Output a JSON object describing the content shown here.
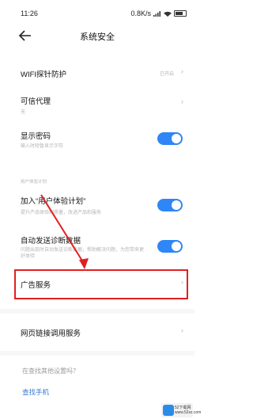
{
  "status_bar": {
    "time": "11:26",
    "net_speed": "0.8K/s"
  },
  "header": {
    "title": "系统安全"
  },
  "items": {
    "wifi": {
      "title": "WIFI探针防护",
      "value": "已开启"
    },
    "trusted_agent": {
      "title": "可信代理",
      "subtitle": "无"
    },
    "show_password": {
      "title": "显示密码",
      "subtitle": "输入时短暂显示字符",
      "enabled": true
    },
    "section_label": "用户体验计划",
    "ux_plan": {
      "title": "加入“用户体验计划”",
      "subtitle": "提升产品体验和质量，改进产品和服务",
      "enabled": true
    },
    "auto_diag": {
      "title": "自动发送诊断数据",
      "subtitle": "问题出现时自动发送诊断数据，帮助解决问题，为您带来更好体验",
      "enabled": true
    },
    "ad_service": {
      "title": "广告服务"
    },
    "web_link": {
      "title": "网页链接调用服务"
    }
  },
  "footer": {
    "question": "在查找其他设置吗？",
    "link": "查找手机"
  },
  "watermark": {
    "line1": "52下载网",
    "line2": "www.52xz.com"
  },
  "colors": {
    "accent": "#2f86f6",
    "highlight": "#e02020",
    "link": "#3577d4"
  }
}
